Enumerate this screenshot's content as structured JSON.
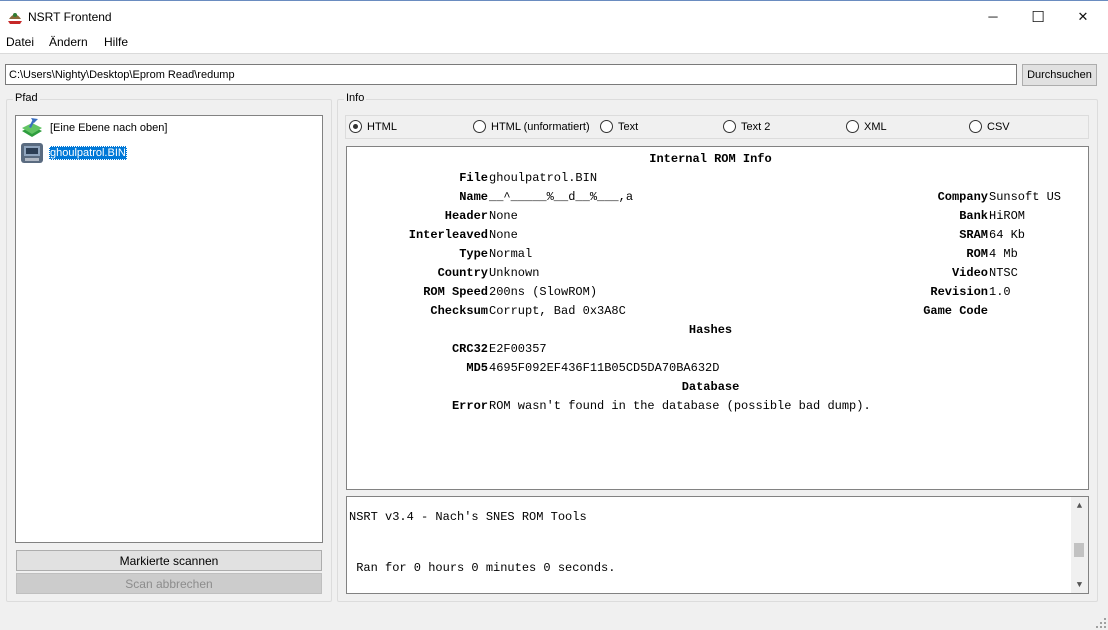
{
  "window": {
    "title": "NSRT Frontend",
    "minimize": "─",
    "maximize": "☐",
    "close": "✕"
  },
  "menu": [
    "Datei",
    "Ändern",
    "Hilfe"
  ],
  "path": {
    "value": "C:\\Users\\Nighty\\Desktop\\Eprom Read\\redump",
    "browse_label": "Durchsuchen"
  },
  "left_panel": {
    "title": "Pfad",
    "items": [
      {
        "label": "[Eine Ebene nach oben]",
        "icon": "folder-up-icon"
      },
      {
        "label": "ghoulpatrol.BIN",
        "icon": "rom-file-icon",
        "selected": true
      }
    ],
    "scan_label": "Markierte scannen",
    "abort_label": "Scan abbrechen"
  },
  "right_panel": {
    "title": "Info",
    "formats": [
      {
        "label": "HTML",
        "checked": true
      },
      {
        "label": "HTML (unformatiert)",
        "checked": false
      },
      {
        "label": "Text",
        "checked": false
      },
      {
        "label": "Text 2",
        "checked": false
      },
      {
        "label": "XML",
        "checked": false
      },
      {
        "label": "CSV",
        "checked": false
      }
    ]
  },
  "rom_info": {
    "heading": "Internal ROM Info",
    "left": [
      {
        "label": "File",
        "value": "ghoulpatrol.BIN"
      },
      {
        "label": "Name",
        "value": "__^_____%__d__%___,a"
      },
      {
        "label": "Header",
        "value": "None"
      },
      {
        "label": "Interleaved",
        "value": "None"
      },
      {
        "label": "Type",
        "value": "Normal"
      },
      {
        "label": "Country",
        "value": "Unknown"
      },
      {
        "label": "ROM Speed",
        "value": "200ns (SlowROM)"
      },
      {
        "label": "Checksum",
        "value": "Corrupt, Bad 0x3A8C"
      }
    ],
    "right": [
      {
        "label": "Company",
        "value": "Sunsoft US"
      },
      {
        "label": "Bank",
        "value": "HiROM"
      },
      {
        "label": "SRAM",
        "value": "64 Kb"
      },
      {
        "label": "ROM",
        "value": "4 Mb"
      },
      {
        "label": "Video",
        "value": "NTSC"
      },
      {
        "label": "Revision",
        "value": "1.0"
      },
      {
        "label": "Game Code",
        "value": ""
      }
    ],
    "hashes_heading": "Hashes",
    "hashes": [
      {
        "label": "CRC32",
        "value": "E2F00357"
      },
      {
        "label": "MD5",
        "value": "4695F092EF436F11B05CD5DA70BA632D"
      }
    ],
    "database_heading": "Database",
    "database": [
      {
        "label": "Error",
        "value": "ROM wasn't found in the database (possible bad dump)."
      }
    ]
  },
  "log": {
    "line1": "NSRT v3.4 - Nach's SNES ROM Tools",
    "line2": " Ran for 0 hours 0 minutes 0 seconds."
  }
}
